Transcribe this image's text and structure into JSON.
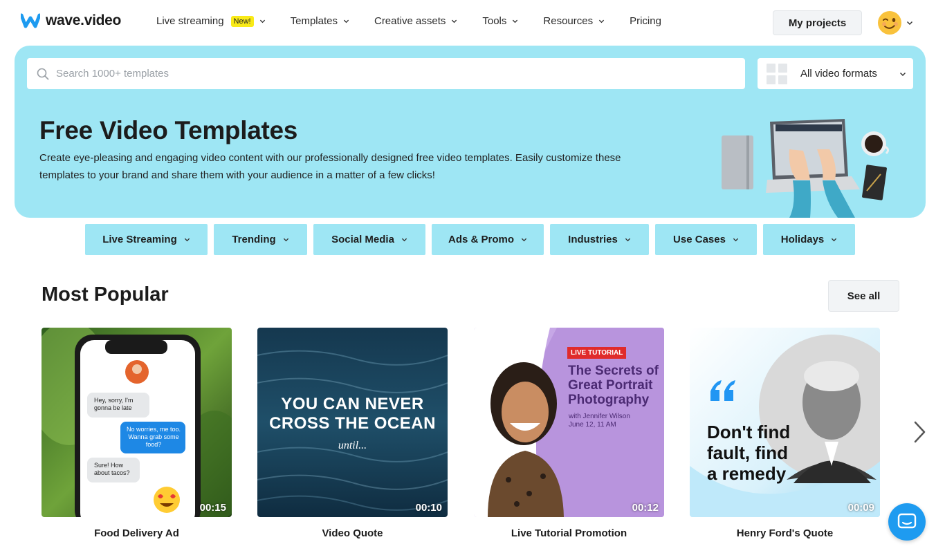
{
  "brand": {
    "name": "wave.video",
    "accent": "#1e9bf0",
    "hero_bg": "#9ee6f4"
  },
  "nav": {
    "items": [
      {
        "label": "Live streaming",
        "badge": "New!",
        "dropdown": true
      },
      {
        "label": "Templates",
        "dropdown": true
      },
      {
        "label": "Creative assets",
        "dropdown": true
      },
      {
        "label": "Tools",
        "dropdown": true
      },
      {
        "label": "Resources",
        "dropdown": true
      },
      {
        "label": "Pricing",
        "dropdown": false
      }
    ],
    "my_projects": "My projects",
    "avatar_icon": "winking-face-icon"
  },
  "search": {
    "placeholder": "Search 1000+ templates",
    "value": ""
  },
  "formats": {
    "selected": "All video formats"
  },
  "hero": {
    "title": "Free Video Templates",
    "description": "Create eye-pleasing and engaging video content with our professionally designed free video templates. Easily customize these templates to your brand and share them with your audience in a matter of a few clicks!"
  },
  "categories": [
    "Live Streaming",
    "Trending",
    "Social Media",
    "Ads & Promo",
    "Industries",
    "Use Cases",
    "Holidays"
  ],
  "popular": {
    "title": "Most Popular",
    "see_all": "See all",
    "cards": [
      {
        "label": "Food Delivery Ad",
        "duration": "00:15",
        "chat": [
          "Hey, sorry, I'm gonna be late",
          "No worries, me too. Wanna grab some food?",
          "Sure! How about tacos?"
        ]
      },
      {
        "label": "Video Quote",
        "duration": "00:10",
        "headline_1": "YOU CAN NEVER",
        "headline_2": "CROSS THE OCEAN",
        "subline": "until..."
      },
      {
        "label": "Live Tutorial Promotion",
        "duration": "00:12",
        "tag": "LIVE TUTORIAL",
        "title_1": "The Secrets of",
        "title_2": "Great Portrait",
        "title_3": "Photography",
        "meta_1": "with Jennifer Wilson",
        "meta_2": "June 12, 11 AM"
      },
      {
        "label": "Henry Ford's Quote",
        "duration": "00:09",
        "quote_1": "Don't find",
        "quote_2": "fault, find",
        "quote_3": "a remedy"
      }
    ]
  }
}
